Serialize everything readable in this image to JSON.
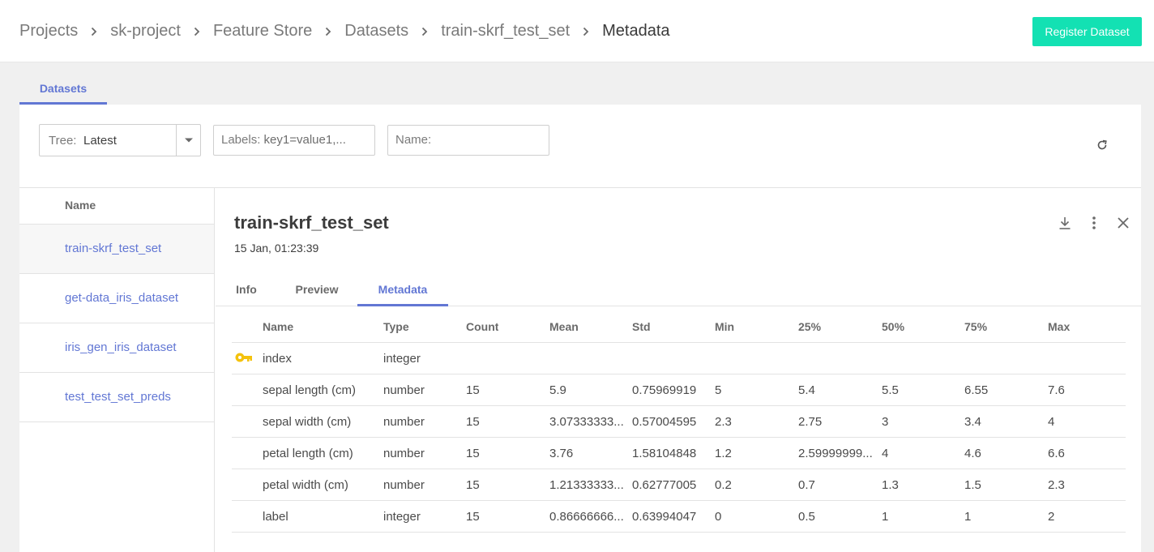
{
  "breadcrumb": {
    "items": [
      "Projects",
      "sk-project",
      "Feature Store",
      "Datasets",
      "train-skrf_test_set"
    ],
    "current": "Metadata"
  },
  "header": {
    "register_label": "Register Dataset"
  },
  "page_tab": {
    "label": "Datasets"
  },
  "filters": {
    "tree_label": "Tree:",
    "tree_value": "Latest",
    "labels_label": "Labels:",
    "labels_value": "key1=value1,...",
    "name_label": "Name:"
  },
  "list": {
    "header": "Name",
    "items": [
      "train-skrf_test_set",
      "get-data_iris_dataset",
      "iris_gen_iris_dataset",
      "test_test_set_preds"
    ]
  },
  "detail": {
    "title": "train-skrf_test_set",
    "date": "15 Jan, 01:23:39",
    "tabs": [
      "Info",
      "Preview",
      "Metadata"
    ],
    "active_tab": "Metadata"
  },
  "table": {
    "columns": [
      "Name",
      "Type",
      "Count",
      "Mean",
      "Std",
      "Min",
      "25%",
      "50%",
      "75%",
      "Max"
    ],
    "rows": [
      [
        "index",
        "integer",
        "",
        "",
        "",
        "",
        "",
        "",
        "",
        ""
      ],
      [
        "sepal length (cm)",
        "number",
        "15",
        "5.9",
        "0.75969919",
        "5",
        "5.4",
        "5.5",
        "6.55",
        "7.6"
      ],
      [
        "sepal width (cm)",
        "number",
        "15",
        "3.07333333...",
        "0.57004595",
        "2.3",
        "2.75",
        "3",
        "3.4",
        "4"
      ],
      [
        "petal length (cm)",
        "number",
        "15",
        "3.76",
        "1.58104848",
        "1.2",
        "2.59999999...",
        "4",
        "4.6",
        "6.6"
      ],
      [
        "petal width (cm)",
        "number",
        "15",
        "1.21333333...",
        "0.62777005",
        "0.2",
        "0.7",
        "1.3",
        "1.5",
        "2.3"
      ],
      [
        "label",
        "integer",
        "15",
        "0.86666666...",
        "0.63994047",
        "0",
        "0.5",
        "1",
        "1",
        "2"
      ]
    ]
  },
  "colors": {
    "accent": "#6277d4",
    "register": "#13e1b3",
    "key_icon": "#f4c20d"
  }
}
